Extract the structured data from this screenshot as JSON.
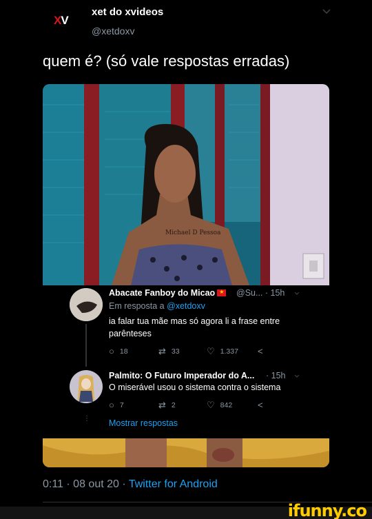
{
  "header": {
    "logo": {
      "x": "X",
      "v": "V"
    },
    "display_name": "xet do xvideos",
    "handle": "@xetdoxv"
  },
  "tweet": {
    "text": "quem é? (só vale respostas erradas)",
    "photo_tattoo_text": "Michael D Pessoa"
  },
  "replies": [
    {
      "name": "Abacate Fanboy do Micao",
      "handle_time": "@Su... · 15h",
      "in_reply_prefix": "Em resposta a ",
      "in_reply_handle": "@xetdoxv",
      "text": "ia falar tua mãe mas só agora li a frase entre parênteses",
      "replies": "18",
      "retweets": "33",
      "likes": "1.337"
    },
    {
      "name": "Palmito: O Futuro Imperador do A...",
      "handle_time": "· 15h",
      "text": "O miserável usou o sistema contra o sistema",
      "replies": "7",
      "retweets": "2",
      "likes": "842"
    }
  ],
  "show_replies": "Mostrar respostas",
  "footer": {
    "time": "0:11 · 08 out 20 · ",
    "source": "Twitter for Android"
  },
  "watermark": "ifunny.co",
  "colors": {
    "background": "#000000",
    "link": "#1da1f2",
    "muted": "#8b98a5",
    "brand_red": "#d9161c",
    "watermark": "#ffcc00"
  },
  "icons": [
    "chevron-down-icon",
    "reply-icon",
    "retweet-icon",
    "like-icon",
    "share-icon"
  ]
}
